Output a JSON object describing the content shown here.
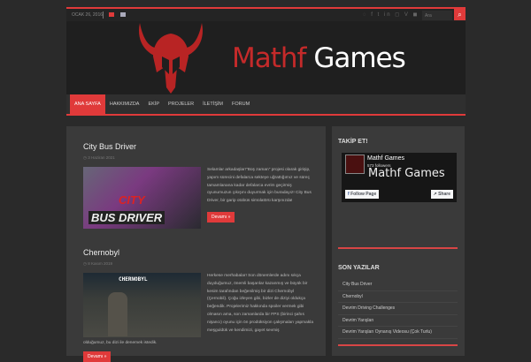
{
  "topbar": {
    "date": "OCAK 26, 2016",
    "search_placeholder": "Ara"
  },
  "header": {
    "title_red": "Mathf",
    "title_white": "Games"
  },
  "nav": [
    "ANA SAYFA",
    "HAKKIMIZDA",
    "EKİP",
    "PROJELER",
    "İLETİŞİM",
    "FORUM"
  ],
  "posts": [
    {
      "title": "City Bus Driver",
      "date": "3 Haziran 2021",
      "image_text": [
        "CITY",
        "BUS DRIVER"
      ],
      "excerpt": "Selamlar arkadaşlar!\"Boş zaman\" projesi olarak girişip, yapım sürecini defalarca sekteye uğrattığımız ve süreç tamamlanana kadar defalarca evrim geçirmiş oyunumuzun çıkışını duyurmak için buradayız! City Bus Driver, bir garip otobüs simülatörü karşınızda!",
      "more": "Devamı »"
    },
    {
      "title": "Chernobyl",
      "date": "8 Kasım 2019",
      "image_text": [
        "CHERNOBYL"
      ],
      "excerpt": "Herkese merhabalar! Son dönemlerde adını sıkça duyduğumuz, önemli başarılar kazanmış ve büyük bir kesim tarafından beğenilmiş bir dizi Chernobyl (Çernobil). Çoğu izleyen gibi, bizler de diziyi oldukça beğendik. Projelerimiz hakkında spoiler vermek gibi olmasın ama, son zamanlarda bir FPS (birinci şahıs nişancı) oyunu için ön prodüksiyon çalışmaları yapmakla meşguldük ve kendimizi, gayet sevmiş",
      "excerpt_tail": "olduğumuz, bu dizi ile denemek istedik.",
      "more": "Devamı »"
    }
  ],
  "sidebar": {
    "follow_title": "TAKİP ET!",
    "fb": {
      "name": "Mathf Games",
      "followers": "573 followers",
      "cover": "Mathf Games",
      "follow": "Follow Page",
      "share": "Share"
    },
    "recent_title": "SON YAZILAR",
    "recent": [
      "City Bus Driver",
      "Chernobyl",
      "Devrim Driving Challenges",
      "Devrim Yarışları",
      "Devrim Yarışları Oynanış Videosu (Çok Turlu)"
    ]
  }
}
